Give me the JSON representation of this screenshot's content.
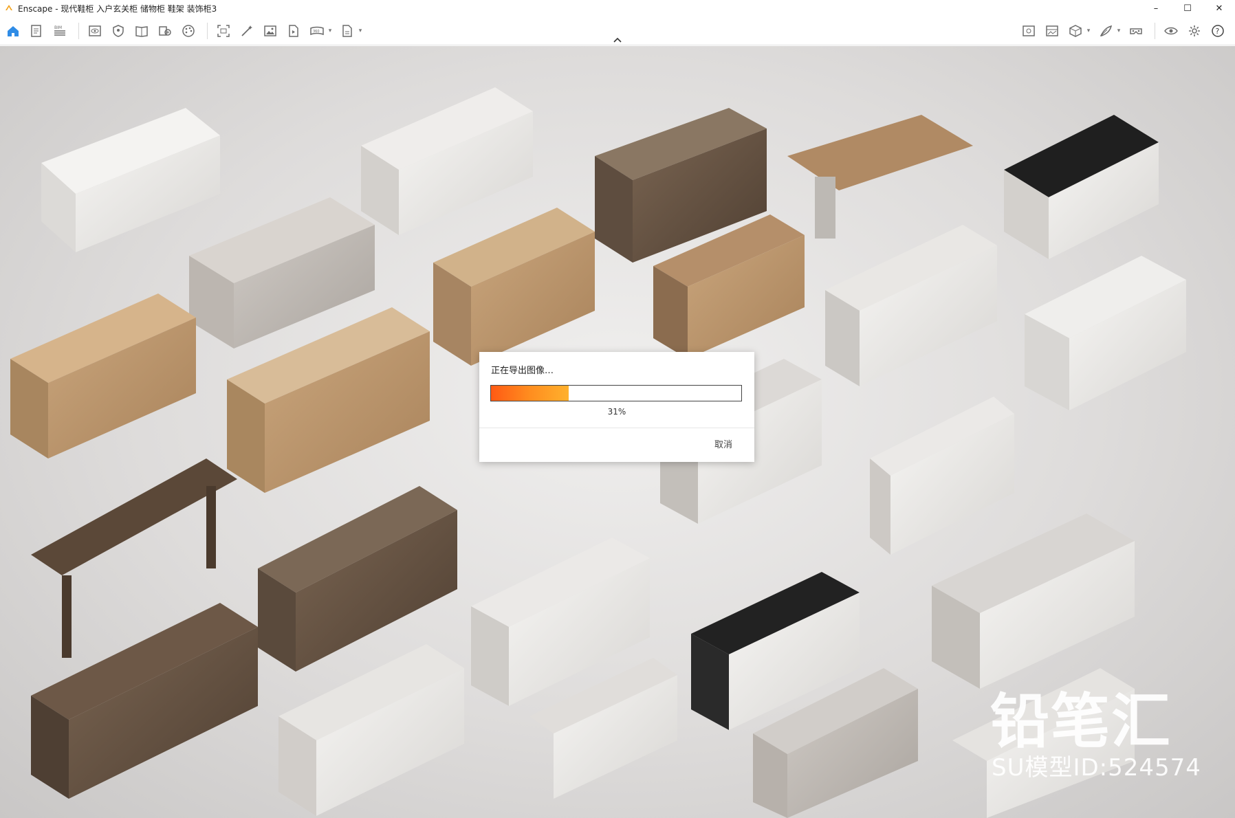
{
  "window": {
    "title": "Enscape - 现代鞋柜 入户玄关柜 储物柜 鞋架 装饰柜3",
    "controls": {
      "minimize": "–",
      "maximize": "☐",
      "close": "✕"
    }
  },
  "toolbar": {
    "left_icons": [
      "home-icon",
      "document-icon",
      "bim-icon",
      "eye-view-icon",
      "shield-icon",
      "book-icon",
      "asset-library-icon",
      "material-palette-icon",
      "screenshot-icon",
      "magic-wand-icon",
      "image-icon",
      "video-file-icon",
      "panorama-icon",
      "export-icon"
    ],
    "bim_label": "BIM",
    "right_icons": [
      "visual-settings-icon",
      "image-compare-icon",
      "cube-icon",
      "feather-icon",
      "vr-headset-icon",
      "eye-icon",
      "settings-gear-icon",
      "help-icon"
    ],
    "colors": {
      "accent": "#2f8ce6",
      "icon": "#6b6b6b"
    }
  },
  "viewport": {
    "watermark_brand": "铅笔汇",
    "watermark_id": "SU模型ID:524574"
  },
  "export_dialog": {
    "title": "正在导出图像…",
    "progress_percent": 31,
    "progress_label": "31%",
    "cancel_label": "取消"
  }
}
